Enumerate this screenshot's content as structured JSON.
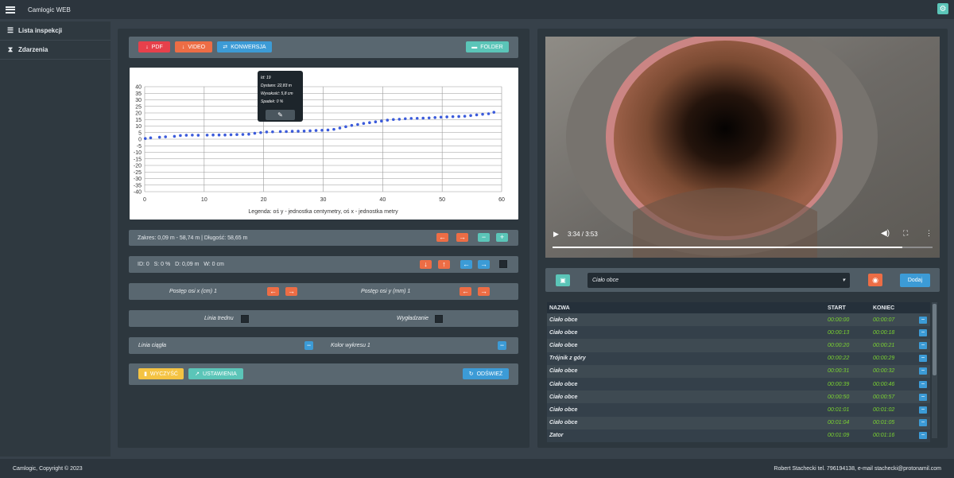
{
  "app": {
    "title": "Camlogic WEB"
  },
  "sidebar": {
    "items": [
      {
        "label": "Lista inspekcji",
        "icon": "list-icon"
      },
      {
        "label": "Zdarzenia",
        "icon": "hourglass-icon"
      }
    ]
  },
  "toolbar": {
    "pdf": "PDF",
    "video": "VIDEO",
    "konwersja": "KONWERSJA",
    "folder": "FOLDER"
  },
  "tooltip": {
    "id": "Id: 19",
    "dystans": "Dystans: 22,83 m",
    "wysokosc": "Wysokość: 5,8 cm",
    "spadek": "Spadek: 0 %"
  },
  "range": {
    "text": "Zakres: 0,09 m - 58,74 m | Długość: 58,65 m"
  },
  "info": {
    "text": "ID: 0   S: 0 %   D: 0,09 m   W: 0 cm"
  },
  "steps": {
    "x": "Postęp osi x (cm) 1",
    "y": "Postęp osi y (mm) 1"
  },
  "options": {
    "trend": "Linia trednu",
    "smooth": "Wygładzanie",
    "solid": "Linia ciągła",
    "color": "Kolor wykresu 1"
  },
  "actions": {
    "clear": "WYCZYŚĆ",
    "settings": "USTAWIENIA",
    "refresh": "ODŚWIEŻ"
  },
  "video": {
    "time": "3:34 / 3:53",
    "progress": 0.92
  },
  "event": {
    "select": "Ciało obce",
    "add": "Dodaj"
  },
  "table": {
    "headers": [
      "NAZWA",
      "START",
      "KONIEC"
    ],
    "rows": [
      [
        "Ciało obce",
        "00:00:00",
        "00:00:07"
      ],
      [
        "Ciało obce",
        "00:00:13",
        "00:00:18"
      ],
      [
        "Ciało obce",
        "00:00:20",
        "00:00:21"
      ],
      [
        "Trójnik z góry",
        "00:00:22",
        "00:00:29"
      ],
      [
        "Ciało obce",
        "00:00:31",
        "00:00:32"
      ],
      [
        "Ciało obce",
        "00:00:39",
        "00:00:46"
      ],
      [
        "Ciało obce",
        "00:00:50",
        "00:00:57"
      ],
      [
        "Ciało obce",
        "00:01:01",
        "00:01:02"
      ],
      [
        "Ciało obce",
        "00:01:04",
        "00:01:05"
      ],
      [
        "Zator",
        "00:01:09",
        "00:01:16"
      ]
    ]
  },
  "footer": {
    "left": "Camlogic, Copyright © 2023",
    "right": "Robert Stachecki tel. 796194138, e-mail stachecki@protonamil.com"
  },
  "chart_data": {
    "type": "scatter",
    "xlabel": "Legenda: oś y - jednostka centymetry, oś x - jednostka metry",
    "ylabel": "",
    "xlim": [
      0,
      60
    ],
    "ylim": [
      -40,
      40
    ],
    "xticks": [
      0,
      10,
      20,
      30,
      40,
      50,
      60
    ],
    "yticks": [
      40,
      35,
      30,
      25,
      20,
      15,
      10,
      5,
      0,
      -5,
      -10,
      -15,
      -20,
      -25,
      -30,
      -35,
      -40
    ],
    "grid": true,
    "color": "#3b5bdb",
    "series": [
      {
        "x": [
          0.1,
          1,
          2.5,
          3.5,
          5,
          6,
          7,
          8,
          9,
          10.5,
          11.5,
          12.5,
          13.5,
          14.5,
          15.5,
          16.5,
          17.5,
          18.5,
          19.5,
          20.5,
          21.5,
          22.8,
          23.8,
          24.8,
          25.8,
          26.8,
          27.8,
          28.8,
          29.8,
          30.8,
          31.8,
          32.8,
          33.8,
          34.8,
          35.8,
          36.8,
          37.8,
          38.8,
          39.8,
          40.8,
          41.8,
          42.8,
          43.8,
          44.8,
          45.8,
          46.8,
          47.8,
          48.8,
          49.8,
          50.8,
          51.8,
          52.8,
          53.8,
          54.8,
          55.8,
          56.8,
          57.8,
          58.7
        ],
        "y": [
          0.5,
          1,
          1.5,
          1.8,
          2.2,
          2.8,
          3,
          3.1,
          3,
          3.1,
          3.2,
          3.2,
          3.2,
          3.4,
          3.5,
          3.6,
          3.8,
          4.5,
          5,
          5.5,
          5.6,
          5.8,
          5.8,
          6,
          6.1,
          6.2,
          6.4,
          6.6,
          6.8,
          7,
          7.5,
          8.5,
          9.5,
          10.5,
          11.2,
          12,
          12.6,
          13.2,
          13.8,
          14.5,
          15,
          15.2,
          15.6,
          15.8,
          15.9,
          16,
          16.2,
          16.5,
          16.8,
          17,
          17.2,
          17.3,
          17.5,
          18,
          18.5,
          19,
          19.4,
          20.5
        ]
      }
    ]
  }
}
